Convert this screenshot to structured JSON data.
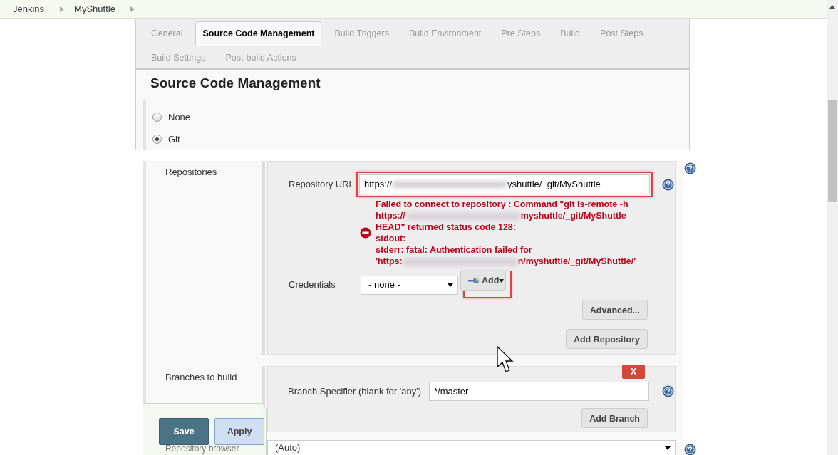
{
  "breadcrumbs": [
    {
      "label": "Jenkins"
    },
    {
      "label": "MyShuttle"
    }
  ],
  "tabs": [
    {
      "label": "General",
      "selected": false
    },
    {
      "label": "Source Code Management",
      "selected": true
    },
    {
      "label": "Build Triggers",
      "selected": false
    },
    {
      "label": "Build Environment",
      "selected": false
    },
    {
      "label": "Pre Steps",
      "selected": false
    },
    {
      "label": "Build",
      "selected": false
    },
    {
      "label": "Post Steps",
      "selected": false
    },
    {
      "label": "Build Settings",
      "selected": false
    },
    {
      "label": "Post-build Actions",
      "selected": false
    }
  ],
  "section_title": "Source Code Management",
  "scm_options": [
    {
      "label": "None",
      "selected": false
    },
    {
      "label": "Git",
      "selected": true
    }
  ],
  "repositories": {
    "label": "Repositories",
    "url": {
      "label": "Repository URL",
      "highlighted": true,
      "value": [
        {
          "text": "https://"
        },
        {
          "redacted": true
        },
        {
          "text": "yshuttle/_git/MyShuttle"
        }
      ]
    },
    "error_lines": [
      [
        {
          "text": "Failed to connect to repository : Command \"git ls-remote -h"
        }
      ],
      [
        {
          "text": "https://"
        },
        {
          "redacted": true
        },
        {
          "text": "myshuttle/_git/MyShuttle"
        }
      ],
      [
        {
          "text": "HEAD\" returned status code 128:"
        }
      ],
      [
        {
          "text": "stdout:"
        }
      ],
      [
        {
          "text": "stderr: fatal: Authentication failed for"
        }
      ],
      [
        {
          "text": "'https:"
        },
        {
          "redacted": true
        },
        {
          "text": "n/myshuttle/_git/MyShuttle/'"
        }
      ]
    ],
    "credentials": {
      "label": "Credentials",
      "value": "- none -",
      "add_label": "Add",
      "add_highlighted": true
    },
    "advanced_label": "Advanced...",
    "add_repository_label": "Add Repository"
  },
  "branches": {
    "label": "Branches to build",
    "delete_label": "X",
    "specifier_label": "Branch Specifier (blank for 'any')",
    "specifier_value": "*/master",
    "add_branch_label": "Add Branch"
  },
  "repository_browser": {
    "label": "Repository browser",
    "value": "(Auto)"
  },
  "actions": [
    {
      "label": "Save",
      "kind": "primary"
    },
    {
      "label": "Apply",
      "kind": "secondary"
    }
  ]
}
